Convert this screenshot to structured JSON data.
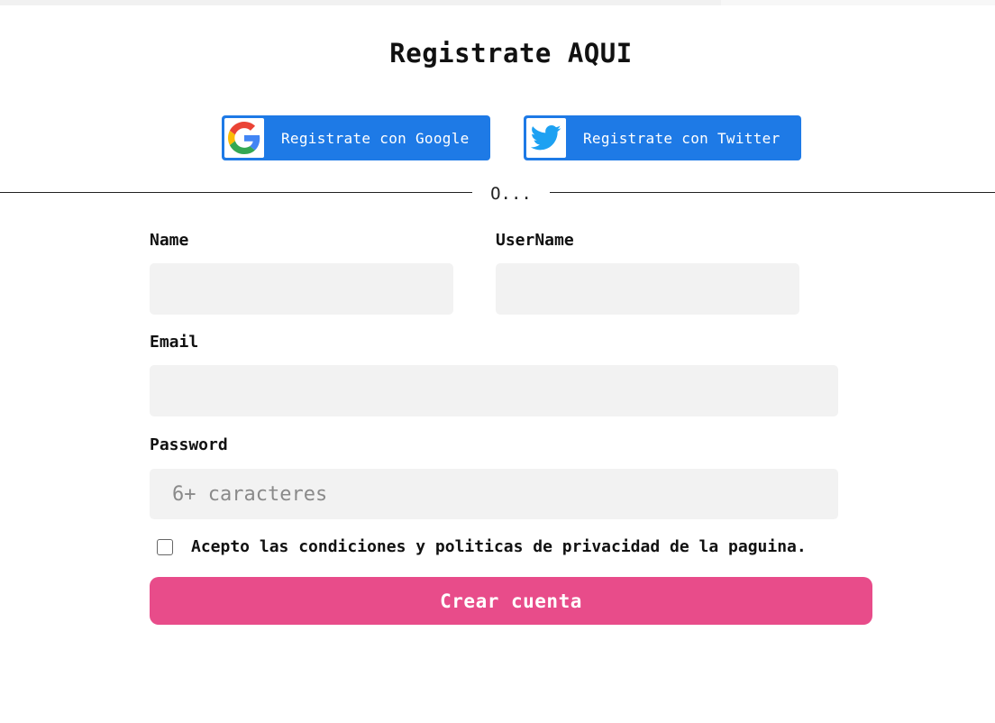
{
  "page": {
    "title": "Registrate AQUI"
  },
  "social": {
    "google": {
      "label": "Registrate con Google",
      "icon": "google-icon"
    },
    "twitter": {
      "label": "Registrate con Twitter",
      "icon": "twitter-icon"
    },
    "button_color": "#1e7ae6"
  },
  "divider": {
    "text": "O..."
  },
  "form": {
    "name": {
      "label": "Name",
      "value": "",
      "placeholder": ""
    },
    "username": {
      "label": "UserName",
      "value": "",
      "placeholder": ""
    },
    "email": {
      "label": "Email",
      "value": "",
      "placeholder": ""
    },
    "password": {
      "label": "Password",
      "value": "",
      "placeholder": "6+ caracteres"
    },
    "terms": {
      "label": "Acepto las condiciones y politicas de privacidad de la paguina.",
      "checked": false
    },
    "submit_label": "Crear cuenta",
    "submit_color": "#e84c8a"
  }
}
